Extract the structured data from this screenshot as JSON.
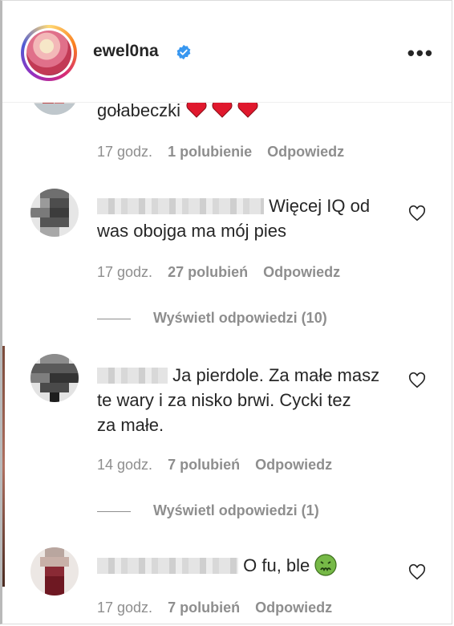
{
  "header": {
    "username": "ewel0na",
    "verified_icon": "verified-badge-icon",
    "more_label": "•••"
  },
  "comments": [
    {
      "text": "gołabeczki",
      "emoji": "red-heart-icon x3",
      "time": "17 godz.",
      "likes": "1 polubienie",
      "reply": "Odpowiedz"
    },
    {
      "text": "Więcej IQ od",
      "text_line2": "was obojga ma mój pies",
      "time": "17 godz.",
      "likes": "27 polubień",
      "reply": "Odpowiedz",
      "view_replies": "Wyświetl odpowiedzi (10)"
    },
    {
      "text": "Ja pierdole. Za małe masz",
      "text_line2": "te wary i za nisko brwi. Cycki tez",
      "text_line3": "za małe.",
      "time": "14 godz.",
      "likes": "7 polubień",
      "reply": "Odpowiedz",
      "view_replies": "Wyświetl odpowiedzi (1)"
    },
    {
      "text": "O fu, ble",
      "emoji": "nauseated-face-icon",
      "time": "17 godz.",
      "likes": "7 polubień",
      "reply": "Odpowiedz"
    }
  ],
  "colors": {
    "text": "#262626",
    "meta": "#8e8e8e",
    "verified": "#3897f0",
    "heart_red": "#e0182d"
  }
}
